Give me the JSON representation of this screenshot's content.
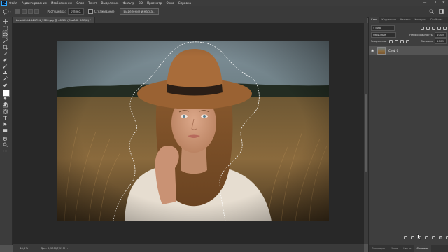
{
  "menu": {
    "logo": "Ps",
    "items": [
      "Файл",
      "Редактирование",
      "Изображение",
      "Слои",
      "Текст",
      "Выделение",
      "Фильтр",
      "3D",
      "Просмотр",
      "Окно",
      "Справка"
    ],
    "window_controls": [
      "—",
      "❐",
      "✕"
    ]
  },
  "options": {
    "feather_label": "Растушевка:",
    "feather_value": "0 пикс.",
    "antialias_label": "Сглаживание",
    "select_mask_label": "Выделение и маска..."
  },
  "document": {
    "tab_title": "beautiful-1844724_1920.jpg @ 46,5% (Слой 0, RGB/8) *",
    "tab_close": "×"
  },
  "status": {
    "zoom": "46,5%",
    "doc_size": "Док: 5,93M/7,91M"
  },
  "panel": {
    "top_tabs": [
      "Слои",
      "Коррекция",
      "Каналы",
      "Контуры",
      "Свойства"
    ],
    "kind_label": "Вид",
    "blend_mode": "Обычные",
    "opacity_label": "Непрозрачность:",
    "opacity_value": "100%",
    "lock_label": "Закрепить:",
    "fill_label": "Заливка:",
    "fill_value": "100%",
    "layer_name": "Слой 0",
    "bottom_tabs": [
      "Операции",
      "Инфо",
      "Кисть",
      "Символы"
    ]
  },
  "colors": {
    "accent": "#31a8ff",
    "app_bg": "#535353",
    "panel_bg": "#3e3e3e",
    "canvas_bg": "#282828"
  },
  "icons": [
    "move-icon",
    "marquee-icon",
    "lasso-icon",
    "quick-select-icon",
    "crop-icon",
    "eyedropper-icon",
    "healing-icon",
    "brush-icon",
    "stamp-icon",
    "history-brush-icon",
    "eraser-icon",
    "gradient-icon",
    "blur-icon",
    "dodge-icon",
    "pen-icon",
    "type-icon",
    "path-select-icon",
    "shape-icon",
    "hand-icon",
    "zoom-icon",
    "more-icon",
    "quick-mask-icon",
    "screen-mode-icon"
  ]
}
